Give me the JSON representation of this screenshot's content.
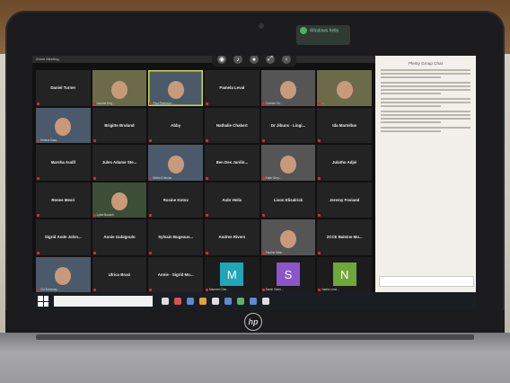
{
  "zoom": {
    "window_title": "Zoom Meeting",
    "participants": [
      {
        "name": "Daniel Turner",
        "type": "name"
      },
      {
        "name": "",
        "type": "video",
        "caption": "Laurine Kng..."
      },
      {
        "name": "",
        "type": "video",
        "caption": "Paul Robinson ...",
        "speaker": true
      },
      {
        "name": "Pamela Leval",
        "type": "name"
      },
      {
        "name": "",
        "type": "video",
        "caption": "Carmen Ch..."
      },
      {
        "name": "",
        "type": "video",
        "caption": "..."
      },
      {
        "name": "",
        "type": "video",
        "caption": "Helena Kass..."
      },
      {
        "name": "Brigitte Bruland",
        "type": "name"
      },
      {
        "name": "Abby",
        "type": "name"
      },
      {
        "name": "Nathalie Chabert",
        "type": "name"
      },
      {
        "name": "Dr Jibuns - Lingi...",
        "type": "name"
      },
      {
        "name": "Ida Martellus",
        "type": "name"
      },
      {
        "name": "Marsha Audif",
        "type": "name"
      },
      {
        "name": "Jules Adame Ste...",
        "type": "name"
      },
      {
        "name": "",
        "type": "video",
        "caption": "Michel Delmas"
      },
      {
        "name": "Ben Des Jardin...",
        "type": "name"
      },
      {
        "name": "",
        "type": "video",
        "caption": "Katie Grey..."
      },
      {
        "name": "Julatho Adjei",
        "type": "name"
      },
      {
        "name": "Renee Mesri",
        "type": "name"
      },
      {
        "name": "",
        "type": "video",
        "caption": "Lydia Bausch"
      },
      {
        "name": "Rosine Kotov",
        "type": "name"
      },
      {
        "name": "Aubr Helix",
        "type": "name"
      },
      {
        "name": "Lison Elisalrick",
        "type": "name"
      },
      {
        "name": "Jeremy Foviand",
        "type": "name"
      },
      {
        "name": "Sigrid Ande Jolvn...",
        "type": "name"
      },
      {
        "name": "Annie Gabigoulo",
        "type": "name"
      },
      {
        "name": "Sylvain Bugeaus...",
        "type": "name"
      },
      {
        "name": "Andree Rivers",
        "type": "name"
      },
      {
        "name": "",
        "type": "video",
        "caption": "Pauline Mele..."
      },
      {
        "name": "2CCE Baleine Mo...",
        "type": "name"
      },
      {
        "name": "",
        "type": "video",
        "caption": "Clo Bohenay..."
      },
      {
        "name": "Ulrica Brasi",
        "type": "name"
      },
      {
        "name": "Annie - Sigrid Mo...",
        "type": "name"
      },
      {
        "name": "",
        "type": "letter",
        "letter": "M",
        "color": "#1fa6b8",
        "caption": "Maureen Dav..."
      },
      {
        "name": "",
        "type": "letter",
        "letter": "S",
        "color": "#8c55c8",
        "caption": "Sarah Gabri..."
      },
      {
        "name": "",
        "type": "letter",
        "letter": "N",
        "color": "#6fa83a",
        "caption": "Nadia Lurat..."
      }
    ]
  },
  "chat": {
    "title": "Plenty Group Chat"
  },
  "sticker": {
    "text": "Windows hello"
  },
  "brand": {
    "logo": "hp"
  }
}
